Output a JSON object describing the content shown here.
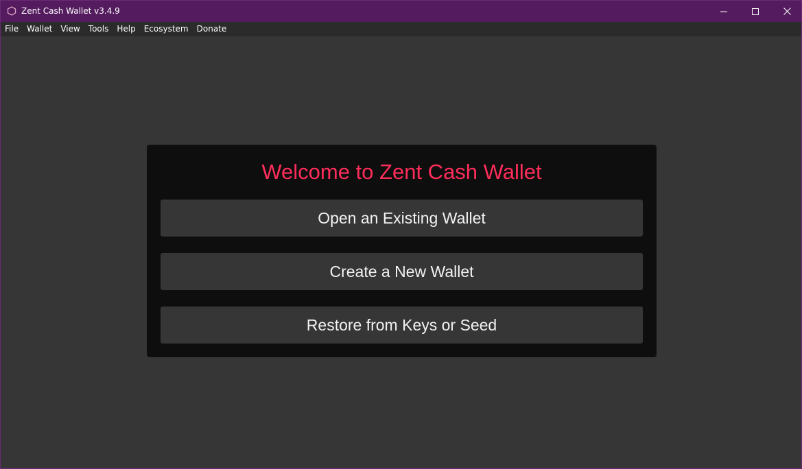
{
  "window": {
    "title": "Zent Cash Wallet v3.4.9",
    "controls": {
      "minimize_icon": "minimize-icon",
      "maximize_icon": "maximize-icon",
      "close_icon": "close-icon"
    }
  },
  "menubar": {
    "items": [
      "File",
      "Wallet",
      "View",
      "Tools",
      "Help",
      "Ecosystem",
      "Donate"
    ]
  },
  "welcome": {
    "title": "Welcome to Zent Cash Wallet",
    "open_label": "Open an Existing Wallet",
    "create_label": "Create a New Wallet",
    "restore_label": "Restore from Keys or Seed"
  },
  "colors": {
    "titlebar": "#541c5e",
    "accent": "#ff2d5a",
    "background": "#363636",
    "panel": "#0e0e0e"
  }
}
